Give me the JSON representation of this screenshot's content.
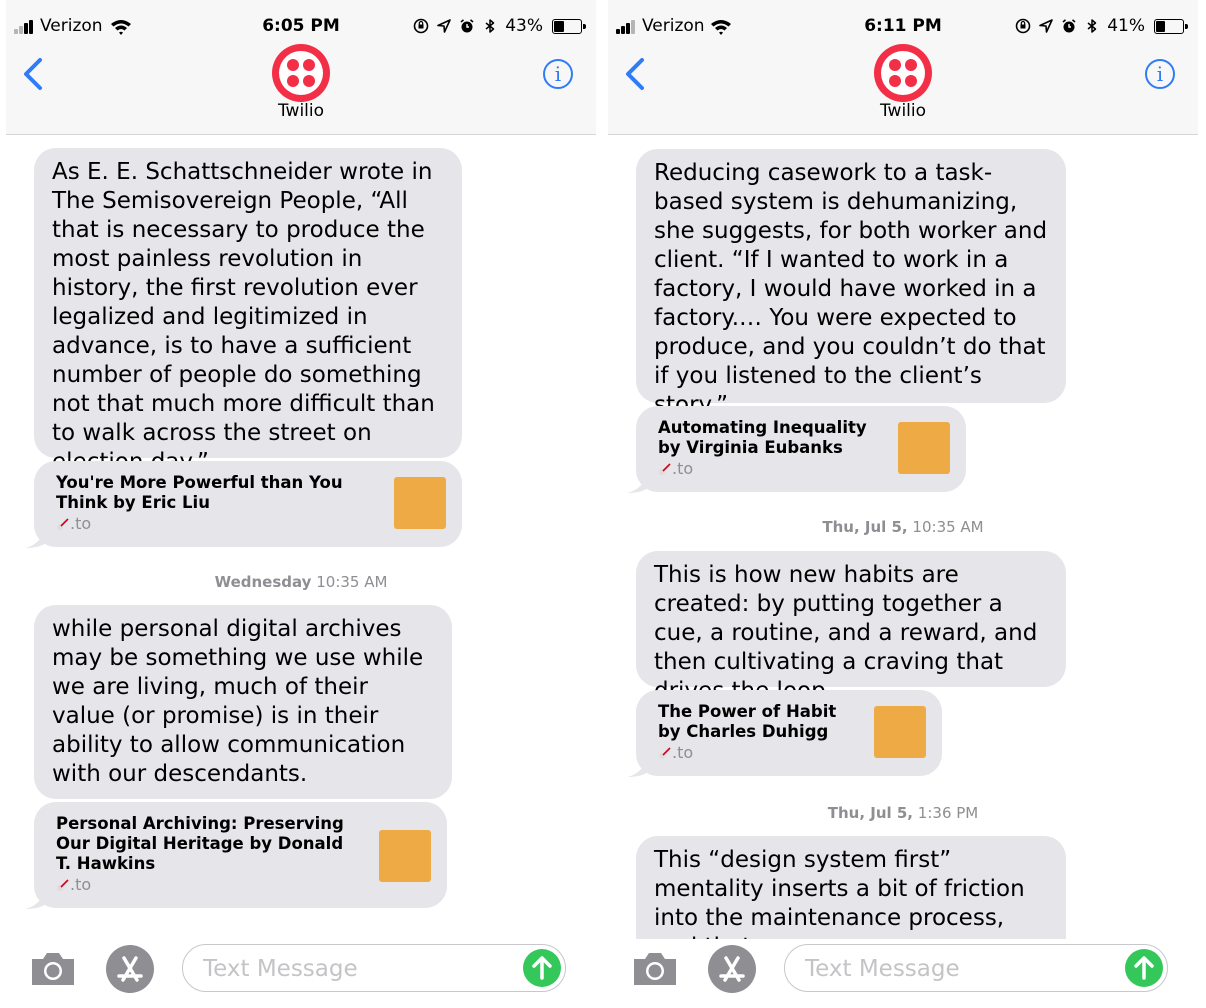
{
  "colors": {
    "accent_blue": "#2f7cf6",
    "bubble_gray": "#e5e5ea",
    "twilio_red": "#f22f46",
    "send_green": "#34c759",
    "thumb_orange": "#edaa45",
    "timestamp_gray": "#8e8e93"
  },
  "screens": [
    {
      "status": {
        "carrier": "Verizon",
        "time": "6:05 PM",
        "battery": "43%",
        "battery_fraction": 0.43
      },
      "header": {
        "contact_name": "Twilio"
      },
      "messages": [
        {
          "type": "text",
          "text": "As E. E. Schattschneider wrote in The Semisovereign People, “All that is necessary to produce the most painless revolution in history, the first revolution ever legalized and legitimized in advance, is to have a sufficient number of people do something not that much more difficult than to walk across the street on election day.”"
        },
        {
          "type": "link",
          "title": "You're More Powerful than You Think by Eric Liu",
          "domain": ".to"
        },
        {
          "type": "timestamp",
          "day": "Wednesday",
          "time": "10:35 AM"
        },
        {
          "type": "text",
          "text": "while personal digital archives may be something we use while we are living, much of their value (or promise) is in their ability to allow communication with our descendants."
        },
        {
          "type": "link",
          "title": "Personal Archiving: Preserving Our Digital Heritage by Donald T. Hawkins",
          "domain": ".to"
        }
      ],
      "input": {
        "placeholder": "Text Message"
      }
    },
    {
      "status": {
        "carrier": "Verizon",
        "time": "6:11 PM",
        "battery": "41%",
        "battery_fraction": 0.41
      },
      "header": {
        "contact_name": "Twilio"
      },
      "messages": [
        {
          "type": "text",
          "text": "Reducing casework to a task-based system is dehumanizing, she suggests, for both worker and client. “If I wanted to work in a factory, I would have worked in a factory.… You were expected to produce, and you couldn’t do that if you listened to the client’s story.”"
        },
        {
          "type": "link",
          "title": "Automating Inequality by Virginia Eubanks",
          "domain": ".to"
        },
        {
          "type": "timestamp",
          "day": "Thu, Jul 5,",
          "time": "10:35 AM"
        },
        {
          "type": "text",
          "text": "This is how new habits are created: by putting together a cue, a routine, and a reward, and then cultivating a craving that drives the loop."
        },
        {
          "type": "link",
          "title": "The Power of Habit by Charles Duhigg",
          "domain": ".to"
        },
        {
          "type": "timestamp",
          "day": "Thu, Jul 5,",
          "time": "1:36 PM"
        },
        {
          "type": "text",
          "text": "This “design system first” mentality inserts a bit of friction into the maintenance process, and that"
        }
      ],
      "input": {
        "placeholder": "Text Message"
      }
    }
  ]
}
